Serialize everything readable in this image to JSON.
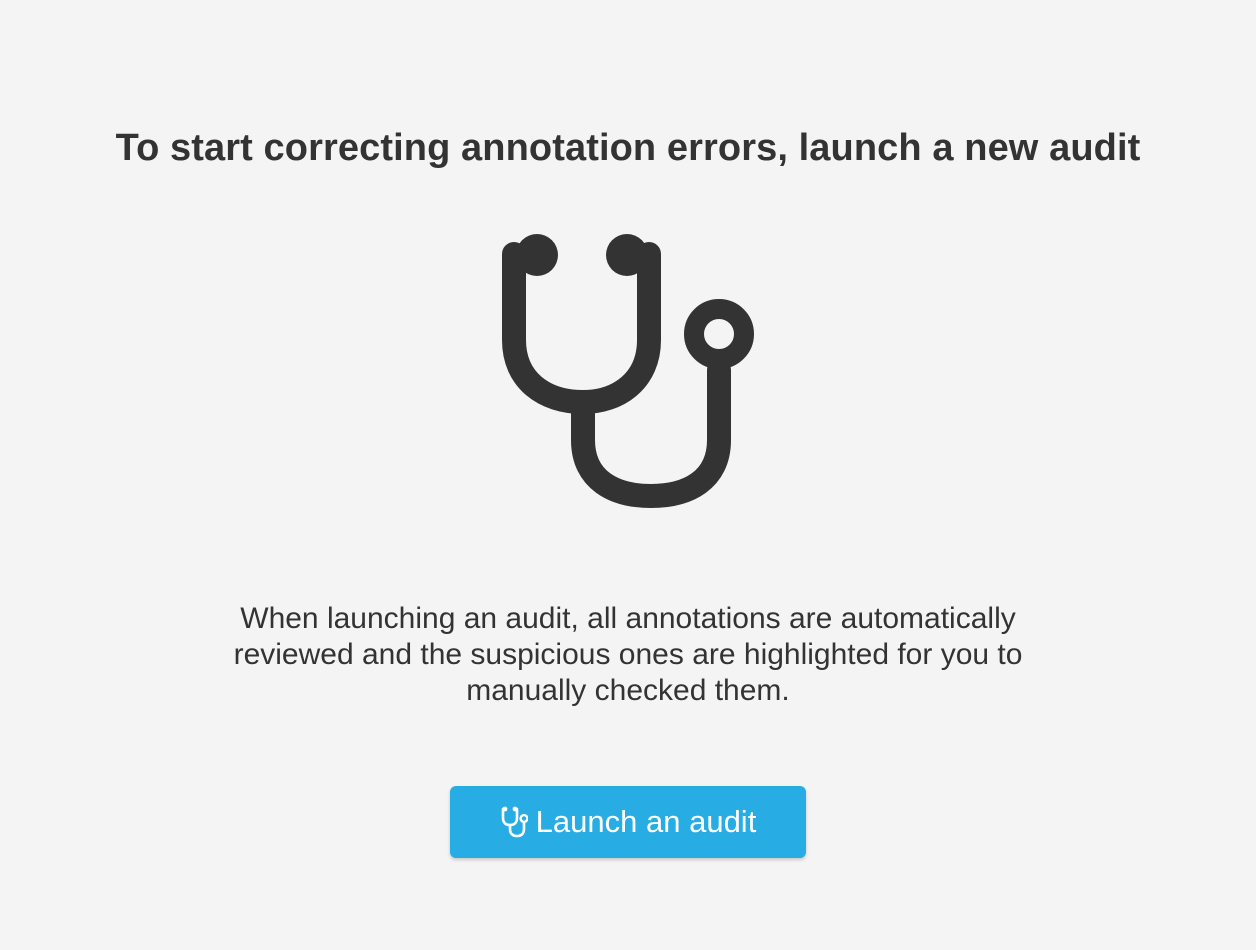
{
  "heading": "To start correcting annotation errors, launch a new audit",
  "hero_icon": "stethoscope-icon",
  "description": "When launching an audit, all annotations are automatically reviewed and the suspicious ones are highlighted for you to manually checked them.",
  "launch_button": {
    "label": "Launch an audit",
    "icon": "stethoscope-icon",
    "color": "#27ade3"
  },
  "colors": {
    "background": "#f4f4f4",
    "text": "#333333",
    "accent": "#27ade3"
  }
}
